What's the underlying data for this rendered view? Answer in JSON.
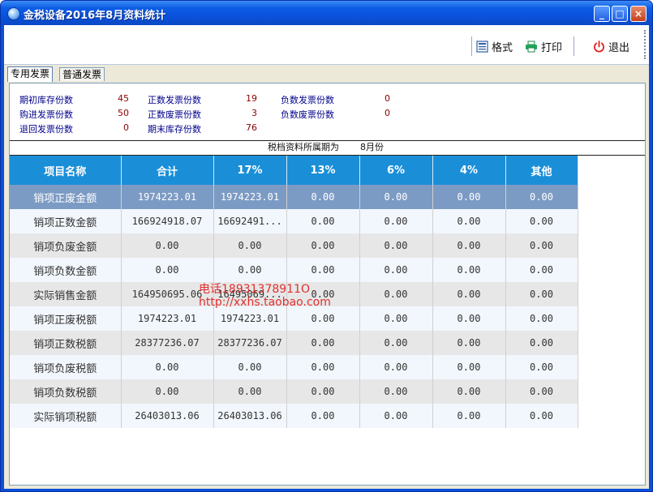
{
  "window": {
    "title": "金税设备2016年8月资料统计",
    "min_label": "_",
    "max_label": "□",
    "close_label": "×"
  },
  "toolbar": {
    "format_label": "格式",
    "print_label": "打印",
    "exit_label": "退出"
  },
  "tabs": [
    {
      "label": "专用发票",
      "active": true
    },
    {
      "label": "普通发票",
      "active": false
    }
  ],
  "stats": [
    {
      "label": "期初库存份数",
      "value": "45"
    },
    {
      "label": "正数发票份数",
      "value": "19"
    },
    {
      "label": "负数发票份数",
      "value": "0"
    },
    {
      "label": "购进发票份数",
      "value": "50"
    },
    {
      "label": "正数废票份数",
      "value": "3"
    },
    {
      "label": "负数废票份数",
      "value": "0"
    },
    {
      "label": "退回发票份数",
      "value": "0"
    },
    {
      "label": "期末库存份数",
      "value": "76"
    }
  ],
  "period": {
    "label": "税档资料所属期为",
    "value": "8月份"
  },
  "table": {
    "columns": [
      "项目名称",
      "合计",
      "17%",
      "13%",
      "6%",
      "4%",
      "其他"
    ],
    "rows": [
      [
        "销项正废金额",
        "1974223.01",
        "1974223.01",
        "0.00",
        "0.00",
        "0.00",
        "0.00"
      ],
      [
        "销项正数金额",
        "166924918.07",
        "16692491...",
        "0.00",
        "0.00",
        "0.00",
        "0.00"
      ],
      [
        "销项负废金额",
        "0.00",
        "0.00",
        "0.00",
        "0.00",
        "0.00",
        "0.00"
      ],
      [
        "销项负数金额",
        "0.00",
        "0.00",
        "0.00",
        "0.00",
        "0.00",
        "0.00"
      ],
      [
        "实际销售金额",
        "164950695.06",
        "16495069...",
        "0.00",
        "0.00",
        "0.00",
        "0.00"
      ],
      [
        "销项正废税额",
        "1974223.01",
        "1974223.01",
        "0.00",
        "0.00",
        "0.00",
        "0.00"
      ],
      [
        "销项正数税额",
        "28377236.07",
        "28377236.07",
        "0.00",
        "0.00",
        "0.00",
        "0.00"
      ],
      [
        "销项负废税额",
        "0.00",
        "0.00",
        "0.00",
        "0.00",
        "0.00",
        "0.00"
      ],
      [
        "销项负数税额",
        "0.00",
        "0.00",
        "0.00",
        "0.00",
        "0.00",
        "0.00"
      ],
      [
        "实际销项税额",
        "26403013.06",
        "26403013.06",
        "0.00",
        "0.00",
        "0.00",
        "0.00"
      ]
    ]
  },
  "watermark": {
    "line1": "电话18931378911O",
    "line2": "http://xxhs.taobao.com"
  },
  "colors": {
    "header": "#1a8fd8",
    "selected_row": "#7c9bc4",
    "stat_label": "#00008b",
    "stat_value": "#8b0000"
  }
}
